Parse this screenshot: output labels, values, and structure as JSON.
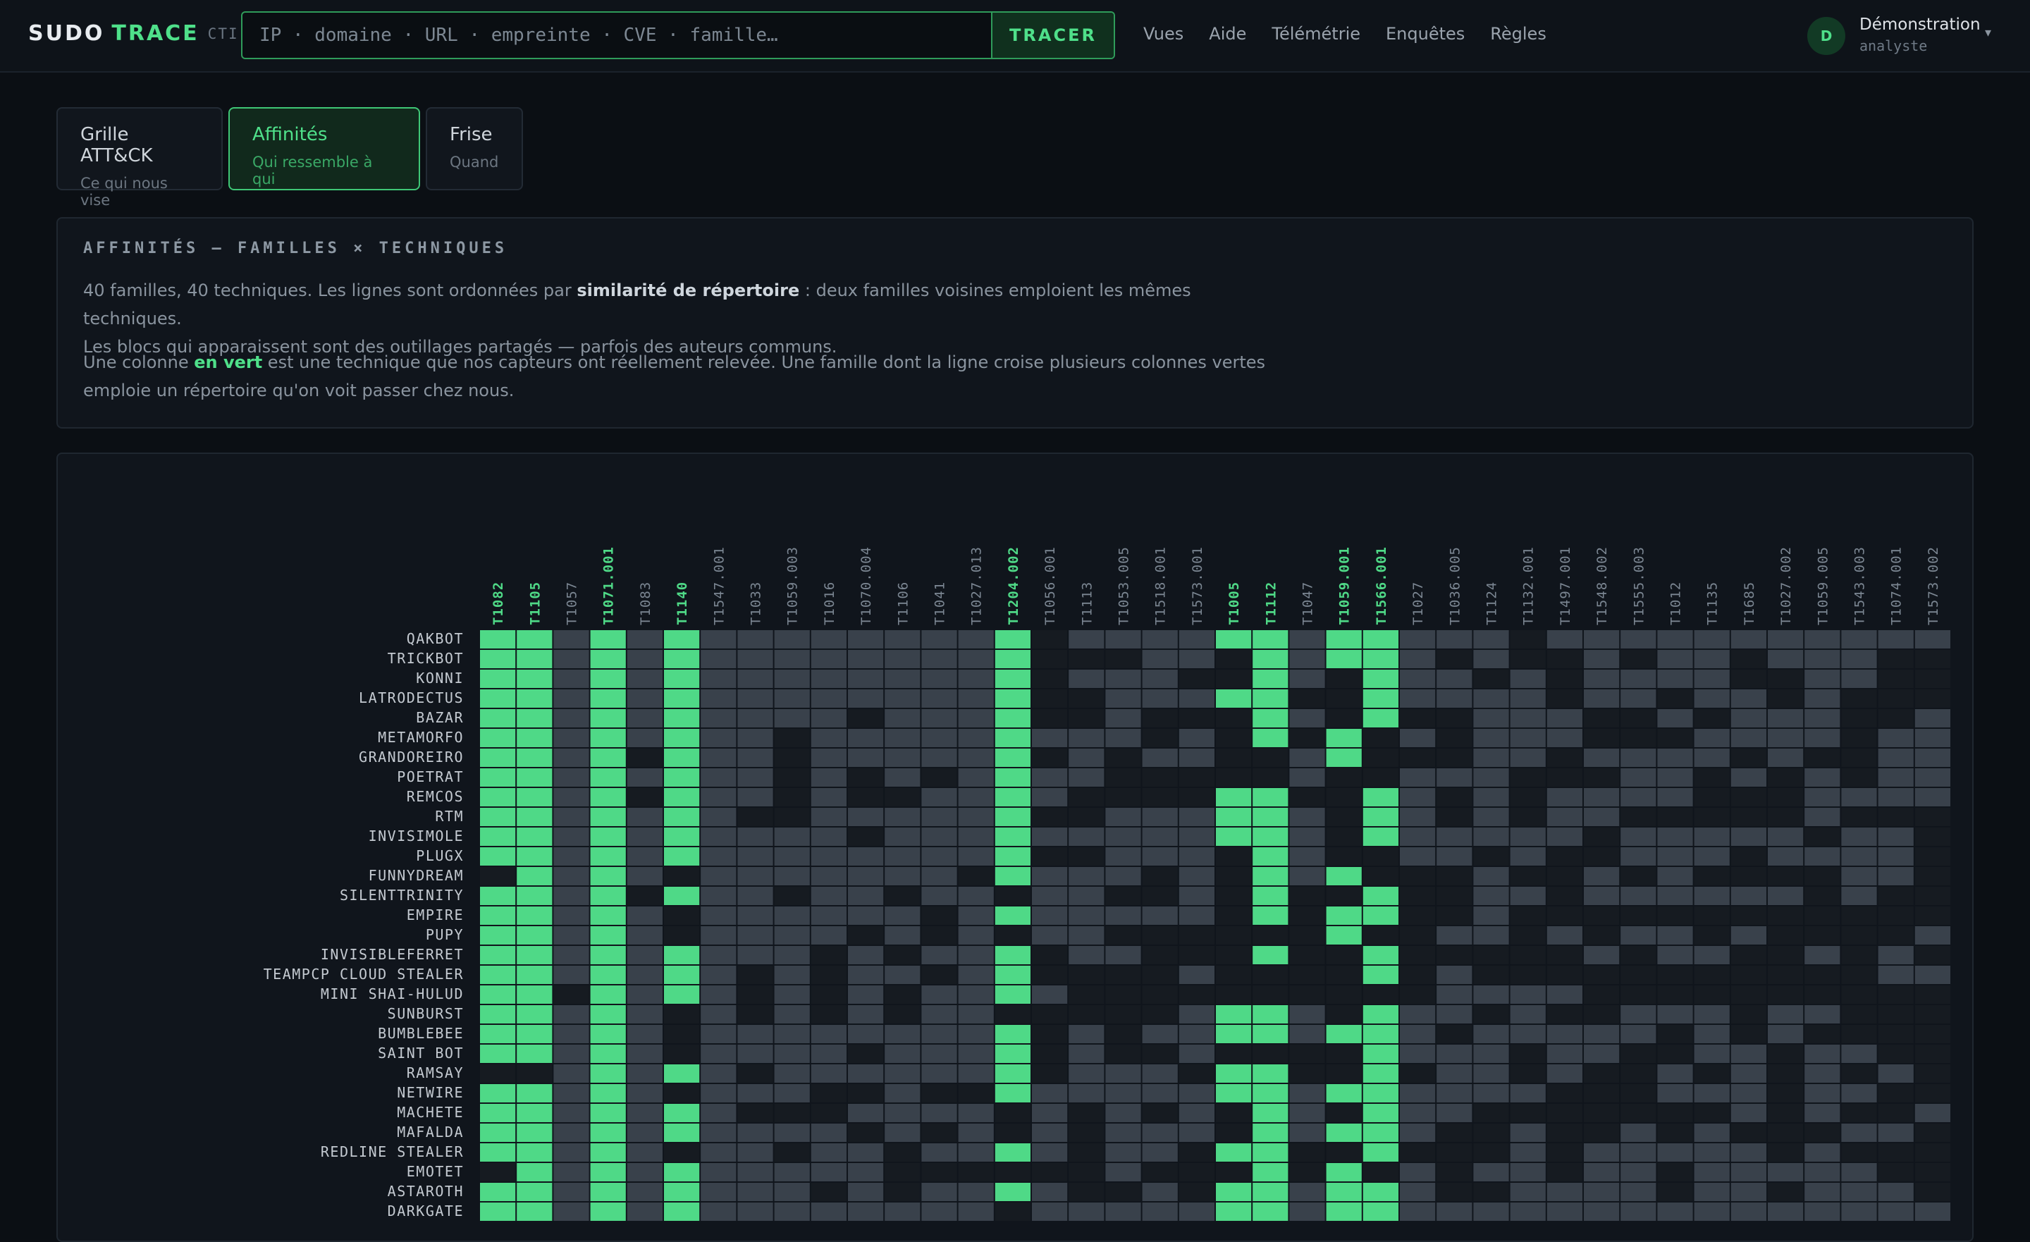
{
  "app": {
    "brand_sudo": "SUDO",
    "brand_trace": "TRACE",
    "brand_tag": "CTI"
  },
  "search": {
    "placeholder": "IP · domaine · URL · empreinte · CVE · famille…",
    "button_label": "TRACER"
  },
  "nav": {
    "items": [
      {
        "label": "Vues"
      },
      {
        "label": "Aide"
      },
      {
        "label": "Télémétrie"
      },
      {
        "label": "Enquêtes"
      },
      {
        "label": "Règles"
      }
    ]
  },
  "user": {
    "initial": "D",
    "name": "Démonstration",
    "role": "analyste"
  },
  "tabs": [
    {
      "title": "Grille ATT&CK",
      "subtitle": "Ce qui nous vise",
      "active": false
    },
    {
      "title": "Affinités",
      "subtitle": "Qui ressemble à qui",
      "active": true
    },
    {
      "title": "Frise",
      "subtitle": "Quand",
      "active": false
    }
  ],
  "info": {
    "title": "AFFINITÉS — FAMILLES × TECHNIQUES",
    "p1_a": "40 familles, 40 techniques. Les lignes sont ordonnées par ",
    "p1_b": "similarité de répertoire",
    "p1_c": " : deux familles voisines emploient les mêmes techniques.",
    "p1_d": "Les blocs qui apparaissent sont des outillages partagés — parfois des auteurs communs.",
    "p2_a": "Une colonne ",
    "p2_b": "en vert",
    "p2_c": " est une technique que nos capteurs ont réellement relevée. Une famille dont la ligne croise plusieurs colonnes vertes",
    "p2_d": "emploie un répertoire qu'on voit passer chez nous."
  },
  "matrix": {
    "colors": {
      "observed": "#4fd987",
      "used": "#39414b",
      "empty": "#161b21",
      "grid": "#0c1015",
      "label": "#c4cad1",
      "col_label": "#7b8692",
      "col_label_hit": "#4fd987"
    },
    "columns": [
      {
        "id": "T1082",
        "observed": true
      },
      {
        "id": "T1105",
        "observed": true
      },
      {
        "id": "T1057",
        "observed": false
      },
      {
        "id": "T1071.001",
        "observed": true
      },
      {
        "id": "T1083",
        "observed": false
      },
      {
        "id": "T1140",
        "observed": true
      },
      {
        "id": "T1547.001",
        "observed": false
      },
      {
        "id": "T1033",
        "observed": false
      },
      {
        "id": "T1059.003",
        "observed": false
      },
      {
        "id": "T1016",
        "observed": false
      },
      {
        "id": "T1070.004",
        "observed": false
      },
      {
        "id": "T1106",
        "observed": false
      },
      {
        "id": "T1041",
        "observed": false
      },
      {
        "id": "T1027.013",
        "observed": false
      },
      {
        "id": "T1204.002",
        "observed": true
      },
      {
        "id": "T1056.001",
        "observed": false
      },
      {
        "id": "T1113",
        "observed": false
      },
      {
        "id": "T1053.005",
        "observed": false
      },
      {
        "id": "T1518.001",
        "observed": false
      },
      {
        "id": "T1573.001",
        "observed": false
      },
      {
        "id": "T1005",
        "observed": true
      },
      {
        "id": "T1112",
        "observed": true
      },
      {
        "id": "T1047",
        "observed": false
      },
      {
        "id": "T1059.001",
        "observed": true
      },
      {
        "id": "T1566.001",
        "observed": true
      },
      {
        "id": "T1027",
        "observed": false
      },
      {
        "id": "T1036.005",
        "observed": false
      },
      {
        "id": "T1124",
        "observed": false
      },
      {
        "id": "T1132.001",
        "observed": false
      },
      {
        "id": "T1497.001",
        "observed": false
      },
      {
        "id": "T1548.002",
        "observed": false
      },
      {
        "id": "T1555.003",
        "observed": false
      },
      {
        "id": "T1012",
        "observed": false
      },
      {
        "id": "T1135",
        "observed": false
      },
      {
        "id": "T1685",
        "observed": false
      },
      {
        "id": "T1027.002",
        "observed": false
      },
      {
        "id": "T1059.005",
        "observed": false
      },
      {
        "id": "T1543.003",
        "observed": false
      },
      {
        "id": "T1074.001",
        "observed": false
      },
      {
        "id": "T1573.002",
        "observed": false
      }
    ],
    "rows": [
      {
        "name": "QAKBOT",
        "cells": "1111111111111110111111111111011111111111"
      },
      {
        "name": "TRICKBOT",
        "cells": "1111111111111110001101111101001011011100"
      },
      {
        "name": "KONNI",
        "cells": "1111111111111110111001101110101111001100"
      },
      {
        "name": "LATRODECTUS",
        "cells": "1111111111111110011111001111101101101000"
      },
      {
        "name": "BAZAR",
        "cells": "1111111111011110010001101001110010111001"
      },
      {
        "name": "METAMORFO",
        "cells": "1111111101111111110101010101110001111011"
      },
      {
        "name": "GRANDOREIRO",
        "cells": "1111011101111110101100110001101111010011"
      },
      {
        "name": "POETRAT",
        "cells": "1111111101010111100000100111000110101011"
      },
      {
        "name": "REMCOS",
        "cells": "1111011101001111000011001101011110001111"
      },
      {
        "name": "RTM",
        "cells": "1111111001111110011111101101011000001000"
      },
      {
        "name": "INVISIMOLE",
        "cells": "1111111111011111111111101111110111110110"
      },
      {
        "name": "PLUGX",
        "cells": "1111111111111110011101100110100111011110"
      },
      {
        "name": "FUNNYDREAM",
        "cells": "0111101111111011110101110001001010000110"
      },
      {
        "name": "SILENTTRINITY",
        "cells": "1111011101101101100101001001101111110100"
      },
      {
        "name": "EMPIRE",
        "cells": "1111101111110111111101011001000000000000"
      },
      {
        "name": "PUPY",
        "cells": "1111101111010101100000010011010110100001"
      },
      {
        "name": "INVISIBLEFERRET",
        "cells": "1111111110101110110001001000001011001010"
      },
      {
        "name": "TEAMPCP CLOUD STEALER",
        "cells": "1111111010110110000100001010000000000011"
      },
      {
        "name": "MINI SHAI-HULUD",
        "cells": "1101111010101111000000000011110000000000"
      },
      {
        "name": "SUNBURST",
        "cells": "1111101010101100000111101110100111011000"
      },
      {
        "name": "BUMBLEBEE",
        "cells": "1111101111111110101111111101111101010000"
      },
      {
        "name": "SAINT BOT",
        "cells": "1111101111011110100100001111011001101100"
      },
      {
        "name": "RAMSAY",
        "cells": "0011111011111110111011001011010010101010"
      },
      {
        "name": "NETWIRE",
        "cells": "1111101110010011111111111111100011101100"
      },
      {
        "name": "MACHETE",
        "cells": "1111111000111101010101101110000000101001"
      },
      {
        "name": "MAFALDA",
        "cells": "1111111111010101011101111100100101000110"
      },
      {
        "name": "REDLINE STEALER",
        "cells": "1111101101101111011011001000101111101000"
      },
      {
        "name": "EMOTET",
        "cells": "0111111111100000010001010101101101111100"
      },
      {
        "name": "ASTAROTH",
        "cells": "1111111110101111001011111100111101101110"
      },
      {
        "name": "DARKGATE",
        "cells": "1111111111111101111111111111111111111111"
      }
    ]
  }
}
